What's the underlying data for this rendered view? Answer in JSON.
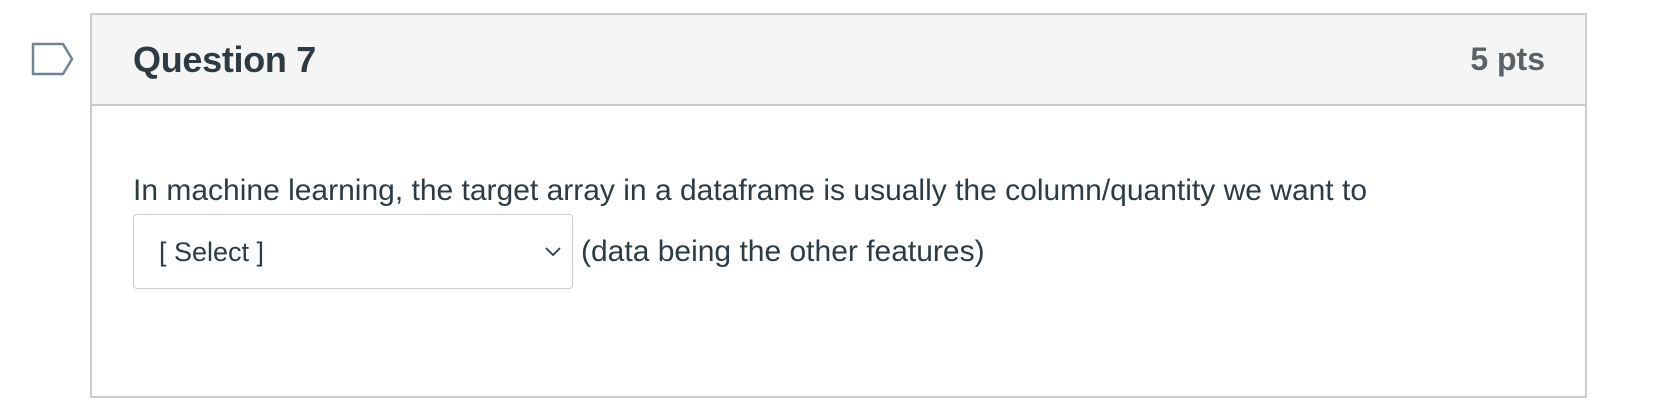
{
  "flag": {
    "icon": "flag-outline-icon"
  },
  "question": {
    "title": "Question 7",
    "points": "5 pts",
    "prompt": "In machine learning, the target array in a dataframe is usually the column/quantity we want to",
    "trailing": "(data being the other features)",
    "select": {
      "value": "[ Select ]",
      "icon": "chevron-down-icon"
    }
  },
  "colors": {
    "border": "#c7cdd1",
    "header_bg": "#f5f5f5",
    "text": "#2d3b45",
    "points_text": "#5b6166",
    "flag_outline": "#6e8599"
  }
}
